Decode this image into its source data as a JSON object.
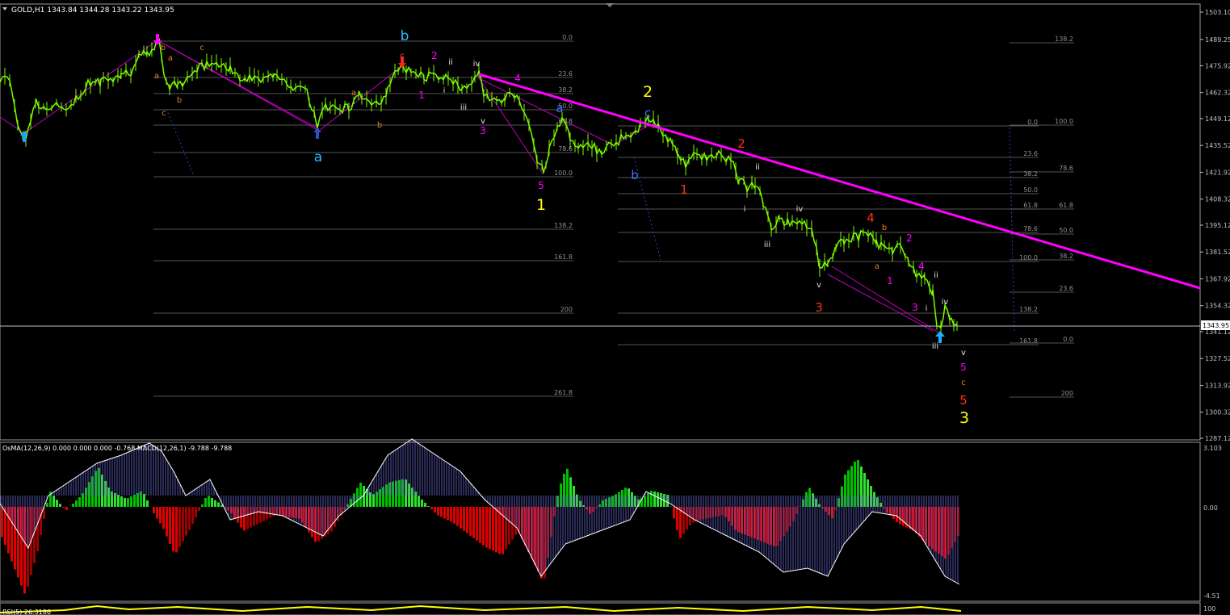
{
  "main": {
    "header": "GOLD,H1  1343.84 1344.28 1343.22 1343.95",
    "price_axis": [
      "1503.10",
      "1489.25",
      "1475.92",
      "1462.32",
      "1449.12",
      "1435.52",
      "1421.92",
      "1408.32",
      "1395.12",
      "1381.52",
      "1367.92",
      "1354.32",
      "1341.12",
      "1327.52",
      "1313.92",
      "1300.32",
      "1287.12"
    ],
    "current_price": "1343.95",
    "colors": {
      "background": "#000000",
      "candle": "#7CFC00",
      "axis": "#c0c0c0",
      "trendline": "#ff00ff",
      "fib": "#808080"
    }
  },
  "chart_data": [
    {
      "type": "line",
      "title": "GOLD,H1",
      "subtitle": "1343.84 1344.28 1343.22 1343.95",
      "ylim": [
        1287.12,
        1503.1
      ],
      "close_path": [
        [
          0,
          1470
        ],
        [
          12,
          1470
        ],
        [
          22,
          1445
        ],
        [
          32,
          1440
        ],
        [
          45,
          1457
        ],
        [
          58,
          1455
        ],
        [
          70,
          1458
        ],
        [
          85,
          1455
        ],
        [
          100,
          1462
        ],
        [
          112,
          1468
        ],
        [
          125,
          1468
        ],
        [
          140,
          1468
        ],
        [
          150,
          1470
        ],
        [
          162,
          1473
        ],
        [
          172,
          1480
        ],
        [
          182,
          1482
        ],
        [
          197,
          1488
        ],
        [
          203,
          1472
        ],
        [
          210,
          1465
        ],
        [
          220,
          1466
        ],
        [
          235,
          1470
        ],
        [
          250,
          1476
        ],
        [
          268,
          1477
        ],
        [
          285,
          1474
        ],
        [
          300,
          1470
        ],
        [
          320,
          1468
        ],
        [
          340,
          1470
        ],
        [
          360,
          1466
        ],
        [
          380,
          1462
        ],
        [
          393,
          1446
        ],
        [
          403,
          1456
        ],
        [
          418,
          1454
        ],
        [
          432,
          1455
        ],
        [
          445,
          1460
        ],
        [
          460,
          1457
        ],
        [
          472,
          1455
        ],
        [
          480,
          1464
        ],
        [
          490,
          1472
        ],
        [
          500,
          1474
        ],
        [
          512,
          1473
        ],
        [
          525,
          1470
        ],
        [
          540,
          1472
        ],
        [
          555,
          1469
        ],
        [
          572,
          1465
        ],
        [
          585,
          1468
        ],
        [
          593,
          1472
        ],
        [
          600,
          1460
        ],
        [
          612,
          1458
        ],
        [
          625,
          1460
        ],
        [
          640,
          1462
        ],
        [
          655,
          1445
        ],
        [
          665,
          1428
        ],
        [
          673,
          1422
        ],
        [
          680,
          1432
        ],
        [
          690,
          1445
        ],
        [
          698,
          1448
        ],
        [
          706,
          1440
        ],
        [
          716,
          1434
        ],
        [
          730,
          1436
        ],
        [
          745,
          1432
        ],
        [
          760,
          1437
        ],
        [
          775,
          1440
        ],
        [
          790,
          1444
        ],
        [
          803,
          1448
        ],
        [
          815,
          1445
        ],
        [
          830,
          1438
        ],
        [
          840,
          1430
        ],
        [
          850,
          1426
        ],
        [
          860,
          1432
        ],
        [
          875,
          1430
        ],
        [
          890,
          1432
        ],
        [
          905,
          1428
        ],
        [
          915,
          1418
        ],
        [
          925,
          1414
        ],
        [
          935,
          1416
        ],
        [
          945,
          1406
        ],
        [
          955,
          1394
        ],
        [
          965,
          1398
        ],
        [
          975,
          1396
        ],
        [
          990,
          1398
        ],
        [
          1005,
          1395
        ],
        [
          1015,
          1374
        ],
        [
          1025,
          1376
        ],
        [
          1035,
          1383
        ],
        [
          1045,
          1388
        ],
        [
          1060,
          1389
        ],
        [
          1075,
          1392
        ],
        [
          1085,
          1386
        ],
        [
          1095,
          1383
        ],
        [
          1105,
          1382
        ],
        [
          1115,
          1384
        ],
        [
          1125,
          1378
        ],
        [
          1135,
          1370
        ],
        [
          1145,
          1368
        ],
        [
          1155,
          1360
        ],
        [
          1160,
          1346
        ],
        [
          1165,
          1343
        ],
        [
          1170,
          1352
        ],
        [
          1178,
          1348
        ],
        [
          1185,
          1344
        ]
      ]
    },
    {
      "type": "bar",
      "title": "OsMA(12,26,9) 0.000 0.000 0.000 -0.768  MACD(12,26,1) -9.788 -9.788",
      "ylim": [
        -4.51,
        3.103
      ],
      "ticks": [
        "3.103",
        "0.00",
        "-4.51"
      ]
    },
    {
      "type": "line",
      "title": "RSI(5) 26.3186",
      "ticks": [
        "100"
      ]
    }
  ],
  "fib_left": [
    "0.0",
    "23.6",
    "38.2",
    "50.0",
    "61.8",
    "78.6",
    "100.0",
    "138.2",
    "161.8",
    "200",
    "261.8"
  ],
  "fib_right_a": [
    "0.0",
    "23.6",
    "38.2",
    "50.0",
    "61.8",
    "78.6",
    "100.0",
    "138.2",
    "161.8"
  ],
  "fib_right_b": [
    "138.2",
    "100.0",
    "78.6",
    "61.8",
    "50.0",
    "38.2",
    "23.6",
    "0.0",
    "200"
  ],
  "labels": {
    "w_b": "b",
    "w_a": "a",
    "w_c_red": "c",
    "w_2_yellow": "2",
    "w_1_yellow": "1",
    "w_3_yellow": "3",
    "w_c_blue": "c",
    "w_a_blue": "a",
    "w_b_blue": "b",
    "w_1_red": "1",
    "w_2_red": "2",
    "w_3_red": "3",
    "w_4_red": "4",
    "w_5_red": "5",
    "w_b_org1": "b",
    "w_a_org1": "a",
    "w_c_org1": "c",
    "w_b_org2": "b",
    "w_c_org2": "c",
    "w_a_org3": "a",
    "w_b_org3": "b",
    "w_a_org4": "a",
    "w_b_org4": "b",
    "w_c_org4": "c",
    "m2": "2",
    "m1": "1",
    "m3": "3",
    "m4": "4",
    "m5": "5",
    "m2b": "2",
    "m1b": "1",
    "m3b": "3",
    "m4b": "4",
    "m5b": "5",
    "r_ii": "ii",
    "r_i": "i",
    "r_iii": "iii",
    "r_iv": "iv",
    "r_v": "v",
    "r_ii2": "ii",
    "r_i2": "i",
    "r_iii2": "iii",
    "r_iv2": "iv",
    "r_v2": "v",
    "r_ii3": "ii",
    "r_i3": "i",
    "r_iii3": "iii",
    "r_iv3": "iv",
    "r_v3": "v"
  }
}
